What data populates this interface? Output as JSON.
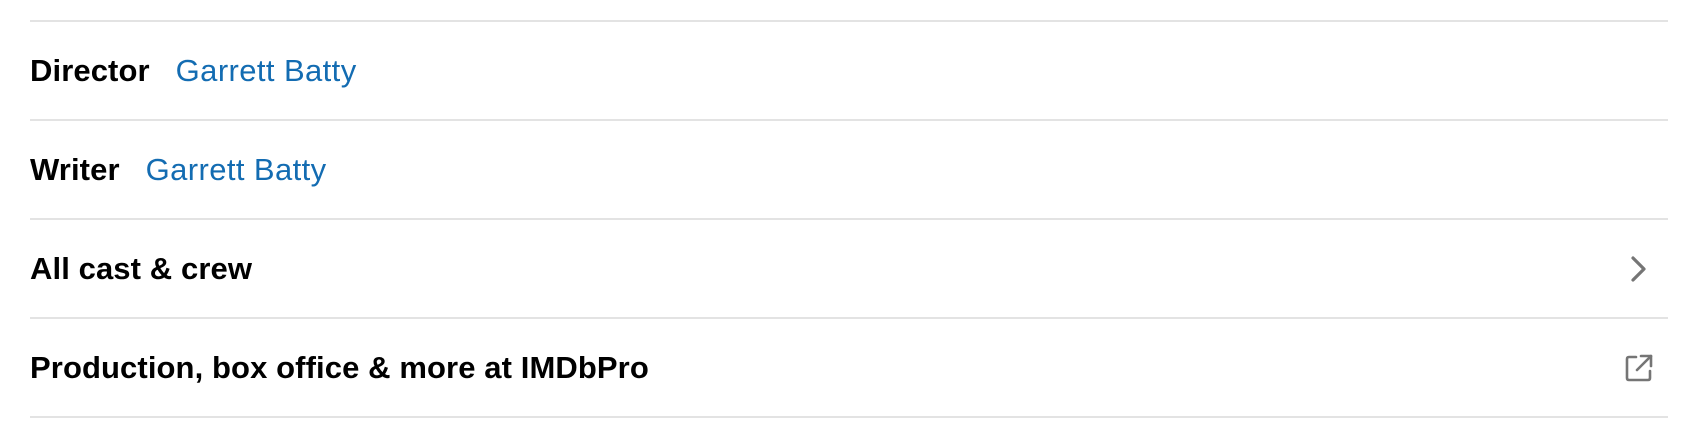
{
  "credits": {
    "director": {
      "label": "Director",
      "name": "Garrett Batty"
    },
    "writer": {
      "label": "Writer",
      "name": "Garrett Batty"
    },
    "all_cast": {
      "label": "All cast & crew",
      "icon": "chevron-right-icon"
    },
    "imdbpro": {
      "label": "Production, box office & more at IMDbPro",
      "icon": "external-link-icon"
    }
  },
  "colors": {
    "link": "#136cb2",
    "divider": "#e3e3e3",
    "icon": "#757575"
  }
}
